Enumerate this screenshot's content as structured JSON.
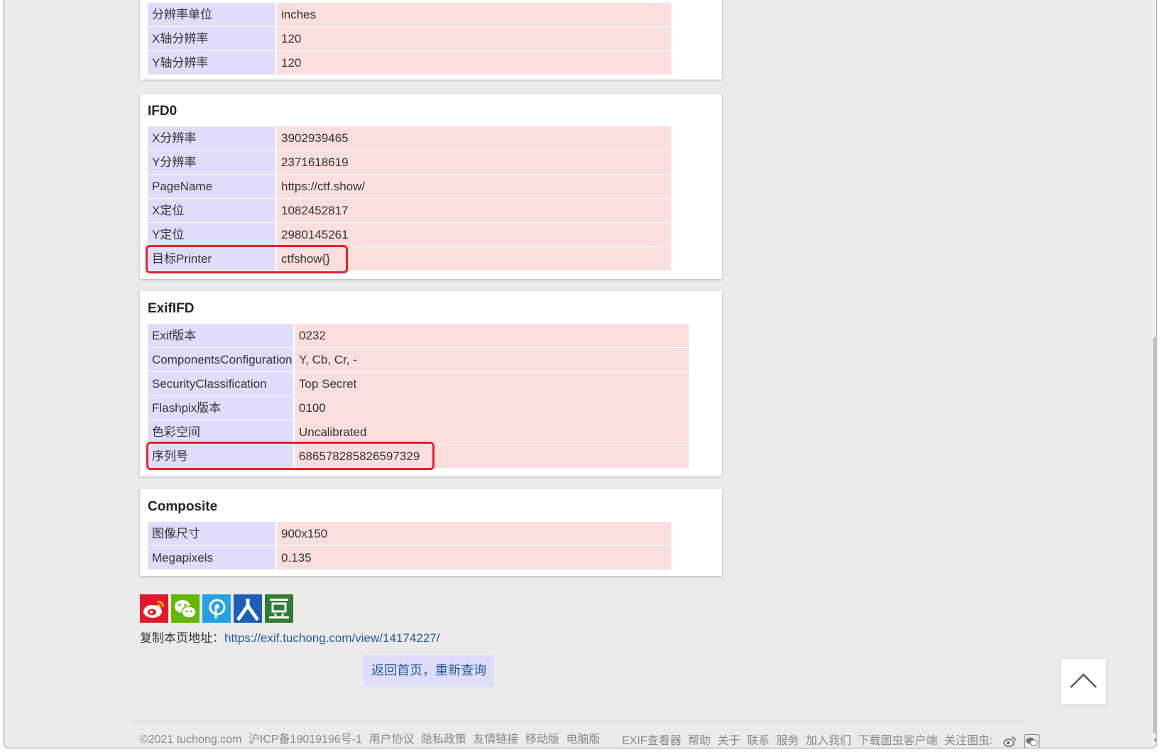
{
  "cards": [
    {
      "id": "resolution",
      "title": "",
      "rows": [
        {
          "key": "分辨率单位",
          "value": "inches"
        },
        {
          "key": "X轴分辨率",
          "value": "120"
        },
        {
          "key": "Y轴分辨率",
          "value": "120"
        }
      ]
    },
    {
      "id": "ifd0",
      "title": "IFD0",
      "rows": [
        {
          "key": "X分辨率",
          "value": "3902939465"
        },
        {
          "key": "Y分辨率",
          "value": "2371618619"
        },
        {
          "key": "PageName",
          "value": "https://ctf.show/"
        },
        {
          "key": "X定位",
          "value": "1082452817"
        },
        {
          "key": "Y定位",
          "value": "2980145261"
        },
        {
          "key": "目标Printer",
          "value": "ctfshow{}"
        }
      ]
    },
    {
      "id": "exififd",
      "title": "ExifIFD",
      "rows": [
        {
          "key": "Exif版本",
          "value": "0232"
        },
        {
          "key": "ComponentsConfiguration",
          "value": "Y, Cb, Cr, -"
        },
        {
          "key": "SecurityClassification",
          "value": "Top Secret"
        },
        {
          "key": "Flashpix版本",
          "value": "0100"
        },
        {
          "key": "色彩空间",
          "value": "Uncalibrated"
        },
        {
          "key": "序列号",
          "value": "686578285826597329"
        }
      ]
    },
    {
      "id": "composite",
      "title": "Composite",
      "rows": [
        {
          "key": "图像尺寸",
          "value": "900x150"
        },
        {
          "key": "Megapixels",
          "value": "0.135"
        }
      ]
    }
  ],
  "share_icons": [
    {
      "name": "weibo-icon",
      "color": "#e6162d"
    },
    {
      "name": "wechat-icon",
      "color": "#62b900"
    },
    {
      "name": "tuchong-icon",
      "color": "#27a1e5"
    },
    {
      "name": "renren-icon",
      "color": "#1d5fb8"
    },
    {
      "name": "douban-icon",
      "color": "#2e7d32"
    }
  ],
  "copy_link": {
    "label": "复制本页地址：",
    "url": "https://exif.tuchong.com/view/14174227/"
  },
  "back_button": "返回首页，重新查询",
  "footer": {
    "left": [
      "©2021 tuchong.com",
      "沪ICP备19019196号-1",
      "用户协议",
      "隐私政策",
      "友情链接",
      "移动版",
      "电脑版"
    ],
    "right": [
      "EXIF查看器",
      "帮助",
      "关于",
      "联系",
      "服务",
      "加入我们",
      "下载图虫客户端",
      "关注图虫:"
    ]
  },
  "highlight_color": "#e8202a"
}
